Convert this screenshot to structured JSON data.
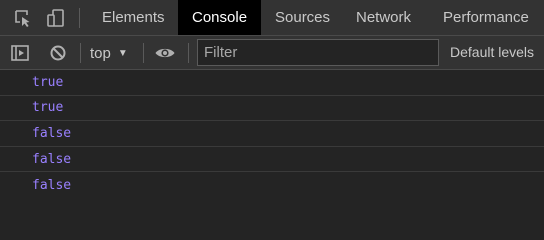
{
  "tabs": {
    "items": [
      {
        "label": "Elements",
        "active": false
      },
      {
        "label": "Console",
        "active": true
      },
      {
        "label": "Sources",
        "active": false
      },
      {
        "label": "Network",
        "active": false
      },
      {
        "label": "Performance",
        "active": false
      }
    ],
    "inspect_icon": "inspect-element-icon",
    "device_icon": "device-toolbar-icon"
  },
  "toolbar": {
    "sidebar_icon": "show-sidebar-icon",
    "clear_icon": "clear-console-icon",
    "context_value": "top",
    "live_expression_icon": "eye-icon",
    "filter_placeholder": "Filter",
    "levels_label": "Default levels"
  },
  "console": {
    "messages": [
      "true",
      "true",
      "false",
      "false",
      "false"
    ]
  },
  "colors": {
    "background": "#242424",
    "toolbar": "#333333",
    "active_tab": "#000000",
    "boolean_value": "#9980ff"
  }
}
